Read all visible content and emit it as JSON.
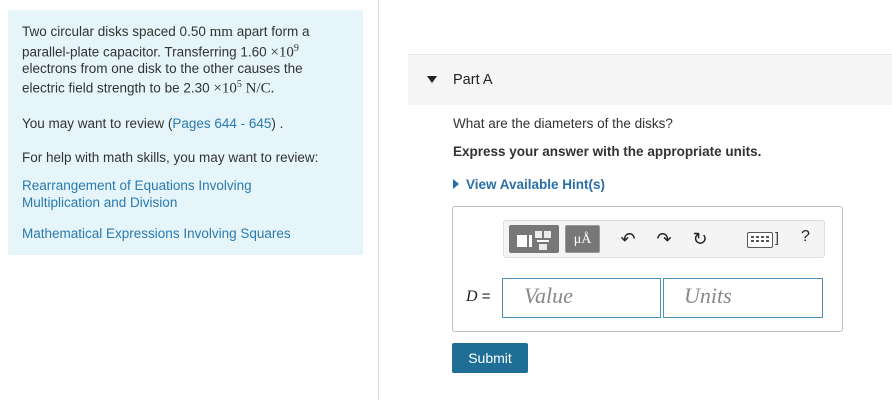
{
  "problem": {
    "line1_pre": "Two circular disks spaced 0.50 ",
    "line1_unit": "mm",
    "line1_post": " apart form a",
    "line2_pre": "parallel-plate capacitor. Transferring 1.60 ",
    "line2_math": "×10",
    "line2_exp": "9",
    "line3": "electrons from one disk to the other causes the",
    "line4_pre": "electric field strength to be 2.30 ",
    "line4_math": "×10",
    "line4_exp": "5",
    "line4_unit": " N/C."
  },
  "review": {
    "prefix": "You may want to review (",
    "link": "Pages 644 - 645",
    "suffix": ") ."
  },
  "help_text": "For help with math skills, you may want to review:",
  "links": {
    "rearrangement": "Rearrangement of Equations Involving Multiplication and Division",
    "math_expressions": "Mathematical Expressions Involving Squares"
  },
  "part": {
    "title": "Part A"
  },
  "question": "What are the diameters of the disks?",
  "instruction": "Express your answer with the appropriate units.",
  "hints_label": "View Available Hint(s)",
  "toolbar": {
    "units_label": "μÅ",
    "undo_glyph": "↶",
    "redo_glyph": "↷",
    "reset_glyph": "↻",
    "kb_bracket": "]",
    "help_glyph": "?"
  },
  "answer": {
    "variable": "D",
    "equals": " =",
    "value_placeholder": "Value",
    "units_placeholder": "Units"
  },
  "submit_label": "Submit",
  "colors": {
    "panel_bg": "#e5f5f9",
    "link": "#2a7ab0",
    "submit_bg": "#1f6e96"
  }
}
